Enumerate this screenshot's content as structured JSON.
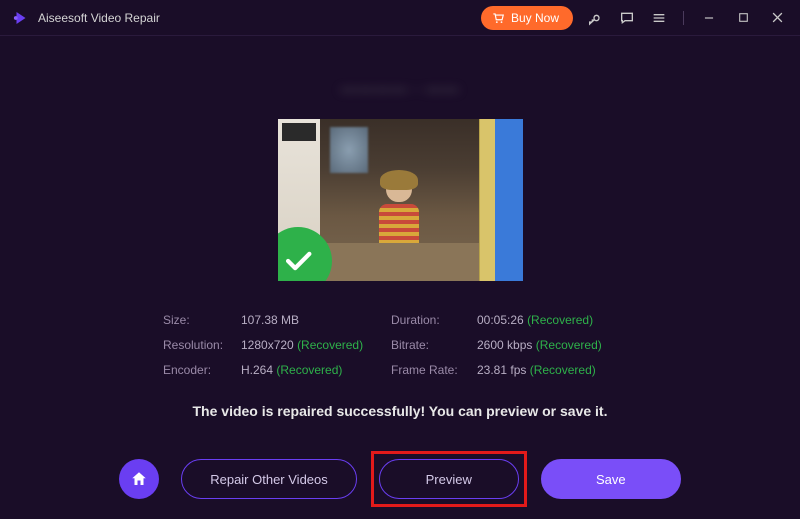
{
  "titlebar": {
    "app_name": "Aiseesoft Video Repair",
    "buy_label": "Buy Now"
  },
  "filename_placeholder": "———— · ——",
  "details": {
    "size_label": "Size:",
    "size_value": "107.38 MB",
    "duration_label": "Duration:",
    "duration_value": "00:05:26",
    "resolution_label": "Resolution:",
    "resolution_value": "1280x720",
    "bitrate_label": "Bitrate:",
    "bitrate_value": "2600 kbps",
    "encoder_label": "Encoder:",
    "encoder_value": "H.264",
    "framerate_label": "Frame Rate:",
    "framerate_value": "23.81 fps",
    "recovered_tag": "(Recovered)"
  },
  "success_message": "The video is repaired successfully! You can preview or save it.",
  "buttons": {
    "repair_other": "Repair Other Videos",
    "preview": "Preview",
    "save": "Save"
  }
}
